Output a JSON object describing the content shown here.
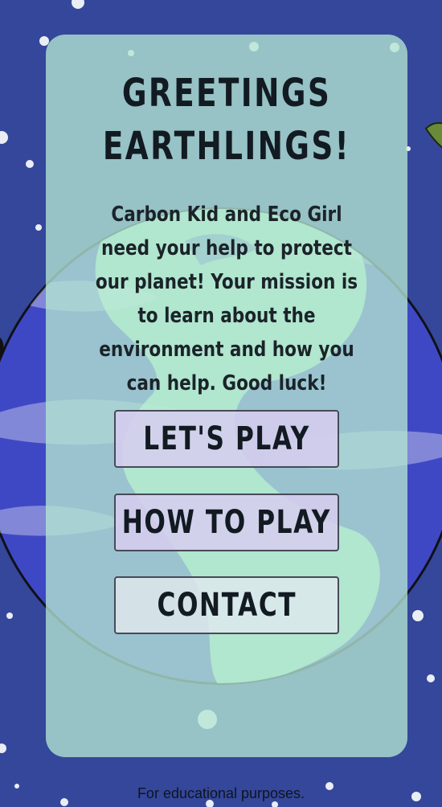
{
  "header": {
    "title_line1": "GREETINGS",
    "title_line2": "EARTHLINGS!"
  },
  "intro": {
    "text": "Carbon Kid and Eco Girl need your help to protect our planet! Your mission is to learn about the environment and how you can help. Good luck!"
  },
  "menu": {
    "play_label": "LET'S PLAY",
    "howto_label": "HOW TO PLAY",
    "contact_label": "CONTACT"
  },
  "footer": {
    "text": "For educational purposes."
  },
  "colors": {
    "background": "#35479a",
    "planet_ocean": "#3f48c4",
    "planet_land": "#a7e9c4",
    "card": "#b4e6d2",
    "button_fill": "#d7cdf0",
    "button_border": "#474a58",
    "text_dark": "#121a22"
  }
}
